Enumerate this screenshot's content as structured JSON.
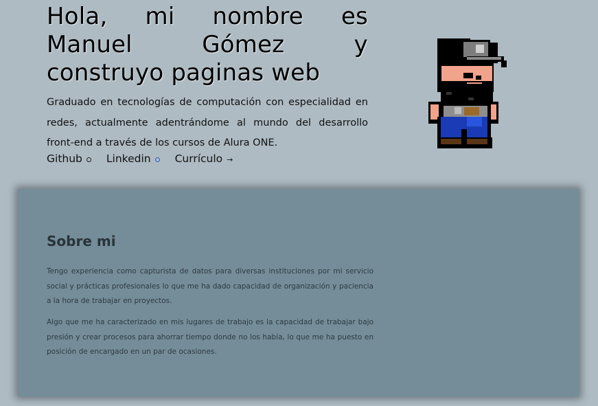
{
  "hero": {
    "title": "Hola, mi nombre es Manuel Gómez y construyo paginas web",
    "description": "Graduado en tecnologías de computación con especialidad en redes, actualmente adentrándome al mundo del desarrollo front-end a través de los cursos de Alura ONE."
  },
  "links": [
    {
      "label": "Github",
      "icon": "circle-icon"
    },
    {
      "label": "Linkedin",
      "icon": "circle-icon"
    },
    {
      "label": "Currículo",
      "icon": "arrow-right-icon"
    }
  ],
  "about": {
    "title": "Sobre mi",
    "paragraphs": [
      "Tengo experiencia como capturista de datos para diversas instituciones por mi servicio social y prácticas profesionales lo que me ha dado capacidad de organización y paciencia a la hora de trabajar en proyectos.",
      "Algo que me ha caracterizado en mis lugares de trabajo es la capacidad de trabajar bajo presión y crear procesos para ahorrar tiempo donde no los había, lo que me ha puesto en posición de encargado en un par de ocasiones."
    ]
  },
  "colors": {
    "background": "#aebbc3",
    "card": "#748d99",
    "linkedin_accent": "#2a63c9"
  }
}
